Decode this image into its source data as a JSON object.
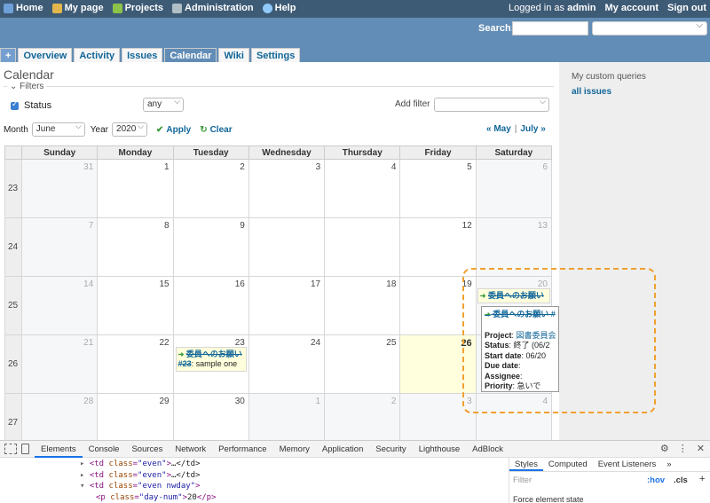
{
  "top_menu": {
    "home": "Home",
    "my_page": "My page",
    "projects": "Projects",
    "administration": "Administration",
    "help": "Help",
    "logged_in_as": "Logged in as",
    "user": "admin",
    "my_account": "My account",
    "sign_out": "Sign out"
  },
  "header": {
    "search_label": "Search:"
  },
  "tabs": [
    "+",
    "Overview",
    "Activity",
    "Issues",
    "Calendar",
    "Wiki",
    "Settings"
  ],
  "page": {
    "title": "Calendar",
    "filters_legend": "Filters",
    "status_label": "Status",
    "status_operator": "any",
    "add_filter_label": "Add filter",
    "month_label": "Month",
    "month_value": "June",
    "year_label": "Year",
    "year_value": "2020",
    "apply": "Apply",
    "clear": "Clear",
    "prev_link": "« May",
    "separator": "|",
    "next_link": "July »"
  },
  "calendar": {
    "weekdays": [
      "Sunday",
      "Monday",
      "Tuesday",
      "Wednesday",
      "Thursday",
      "Friday",
      "Saturday"
    ],
    "weeks": [
      {
        "num": "23",
        "days": [
          "31",
          "1",
          "2",
          "3",
          "4",
          "5",
          "6"
        ]
      },
      {
        "num": "24",
        "days": [
          "7",
          "8",
          "9",
          "",
          "",
          "12",
          "13"
        ]
      },
      {
        "num": "25",
        "days": [
          "14",
          "15",
          "16",
          "17",
          "18",
          "19",
          "20"
        ]
      },
      {
        "num": "26",
        "days": [
          "21",
          "22",
          "23",
          "24",
          "25",
          "26",
          "27"
        ]
      },
      {
        "num": "27",
        "days": [
          "28",
          "29",
          "30",
          "1",
          "2",
          "3",
          "4"
        ]
      }
    ],
    "issue_sat": {
      "subject": "委員へのお願い"
    },
    "issue_tue": {
      "subject": "委員へのお願い",
      "id": "#23",
      "desc": ": sample one"
    }
  },
  "tooltip": {
    "title": "委員へのお願い #",
    "project_label": "Project",
    "project_value": "図書委員会",
    "status_label": "Status",
    "status_value": "終了 (06/2",
    "start_label": "Start date",
    "start_value": "06/20",
    "due_label": "Due date",
    "assignee_label": "Assignee",
    "priority_label": "Priority",
    "priority_value": "急いで"
  },
  "sidebar": {
    "queries_title": "My custom queries",
    "all_issues": "all issues"
  },
  "devtools": {
    "tabs": [
      "Elements",
      "Console",
      "Sources",
      "Network",
      "Performance",
      "Memory",
      "Application",
      "Security",
      "Lighthouse",
      "AdBlock"
    ],
    "code": [
      {
        "tag": "td",
        "cls": "even",
        "text": "…</td>"
      },
      {
        "tag": "td",
        "cls": "even",
        "text": "…</td>"
      },
      {
        "tag": "td",
        "cls": "even nwday",
        "text": ""
      }
    ],
    "p_line": {
      "cls": "day-num",
      "text": "20"
    },
    "styles_tabs": [
      "Styles",
      "Computed",
      "Event Listeners",
      "»"
    ],
    "filter_placeholder": "Filter",
    "hov": ":hov",
    "cls": ".cls",
    "force_state": "Force element state"
  }
}
